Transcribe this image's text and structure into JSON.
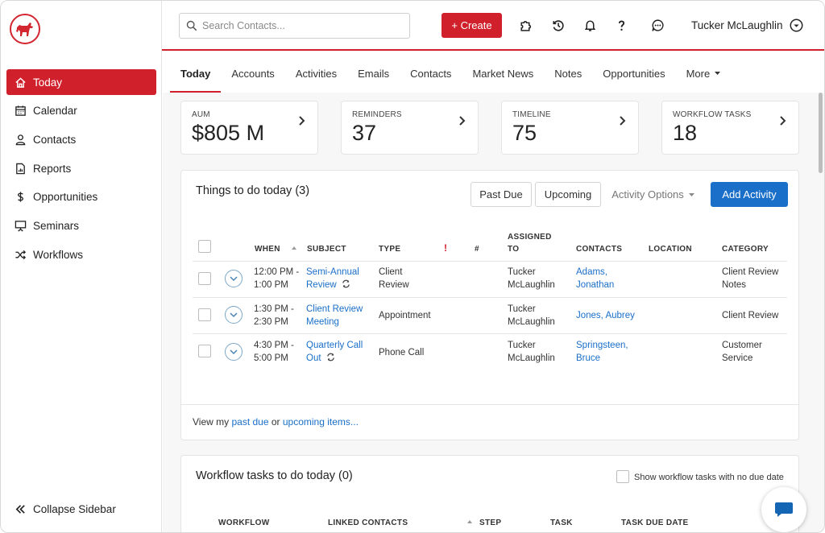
{
  "sidebar": {
    "logo_icon": "dog-icon",
    "items": [
      {
        "label": "Today",
        "icon": "home-icon",
        "active": true
      },
      {
        "label": "Calendar",
        "icon": "calendar-icon"
      },
      {
        "label": "Contacts",
        "icon": "person-icon"
      },
      {
        "label": "Reports",
        "icon": "report-icon"
      },
      {
        "label": "Opportunities",
        "icon": "dollar-icon"
      },
      {
        "label": "Seminars",
        "icon": "presentation-icon"
      },
      {
        "label": "Workflows",
        "icon": "shuffle-icon"
      }
    ],
    "collapse_label": "Collapse Sidebar"
  },
  "header": {
    "search_placeholder": "Search Contacts...",
    "create_label": "+ Create",
    "user_name": "Tucker McLaughlin"
  },
  "tabs": [
    "Today",
    "Accounts",
    "Activities",
    "Emails",
    "Contacts",
    "Market News",
    "Notes",
    "Opportunities",
    "More"
  ],
  "stats": [
    {
      "label": "AUM",
      "value": "$805 M"
    },
    {
      "label": "REMINDERS",
      "value": "37"
    },
    {
      "label": "TIMELINE",
      "value": "75"
    },
    {
      "label": "WORKFLOW TASKS",
      "value": "18"
    }
  ],
  "todo": {
    "title": "Things to do today (3)",
    "buttons": {
      "past_due": "Past Due",
      "upcoming": "Upcoming",
      "activity_options": "Activity Options",
      "add_activity": "Add Activity"
    },
    "columns": {
      "when": "WHEN",
      "subject": "SUBJECT",
      "type": "TYPE",
      "flag": "!",
      "number": "#",
      "assigned_to": "ASSIGNED TO",
      "contacts": "CONTACTS",
      "location": "LOCATION",
      "category": "CATEGORY"
    },
    "rows": [
      {
        "when": "12:00 PM - 1:00 PM",
        "subject": "Semi-Annual Review",
        "type": "Client Review",
        "assigned": "Tucker McLaughlin",
        "contacts": "Adams, Jonathan",
        "location": "",
        "category": "Client Review Notes"
      },
      {
        "when": "1:30 PM - 2:30 PM",
        "subject": "Client Review Meeting",
        "type": "Appointment",
        "assigned": "Tucker McLaughlin",
        "contacts": "Jones, Aubrey",
        "location": "",
        "category": "Client Review"
      },
      {
        "when": "4:30 PM - 5:00 PM",
        "subject": "Quarterly Call Out",
        "type": "Phone Call",
        "assigned": "Tucker McLaughlin",
        "contacts": "Springsteen, Bruce",
        "location": "",
        "category": "Customer Service"
      }
    ],
    "footer": {
      "prefix": "View my ",
      "past_due_link": "past due",
      "middle": " or ",
      "upcoming_link": "upcoming items..."
    }
  },
  "workflow": {
    "title": "Workflow tasks to do today (0)",
    "show_no_due_label": "Show workflow tasks with no due date",
    "columns": {
      "workflow": "WORKFLOW",
      "linked_contacts": "LINKED CONTACTS",
      "step": "STEP",
      "task": "TASK",
      "task_due_date": "TASK DUE DATE"
    }
  },
  "colors": {
    "brand_red": "#d0202b",
    "primary_blue": "#1a6fc9"
  }
}
